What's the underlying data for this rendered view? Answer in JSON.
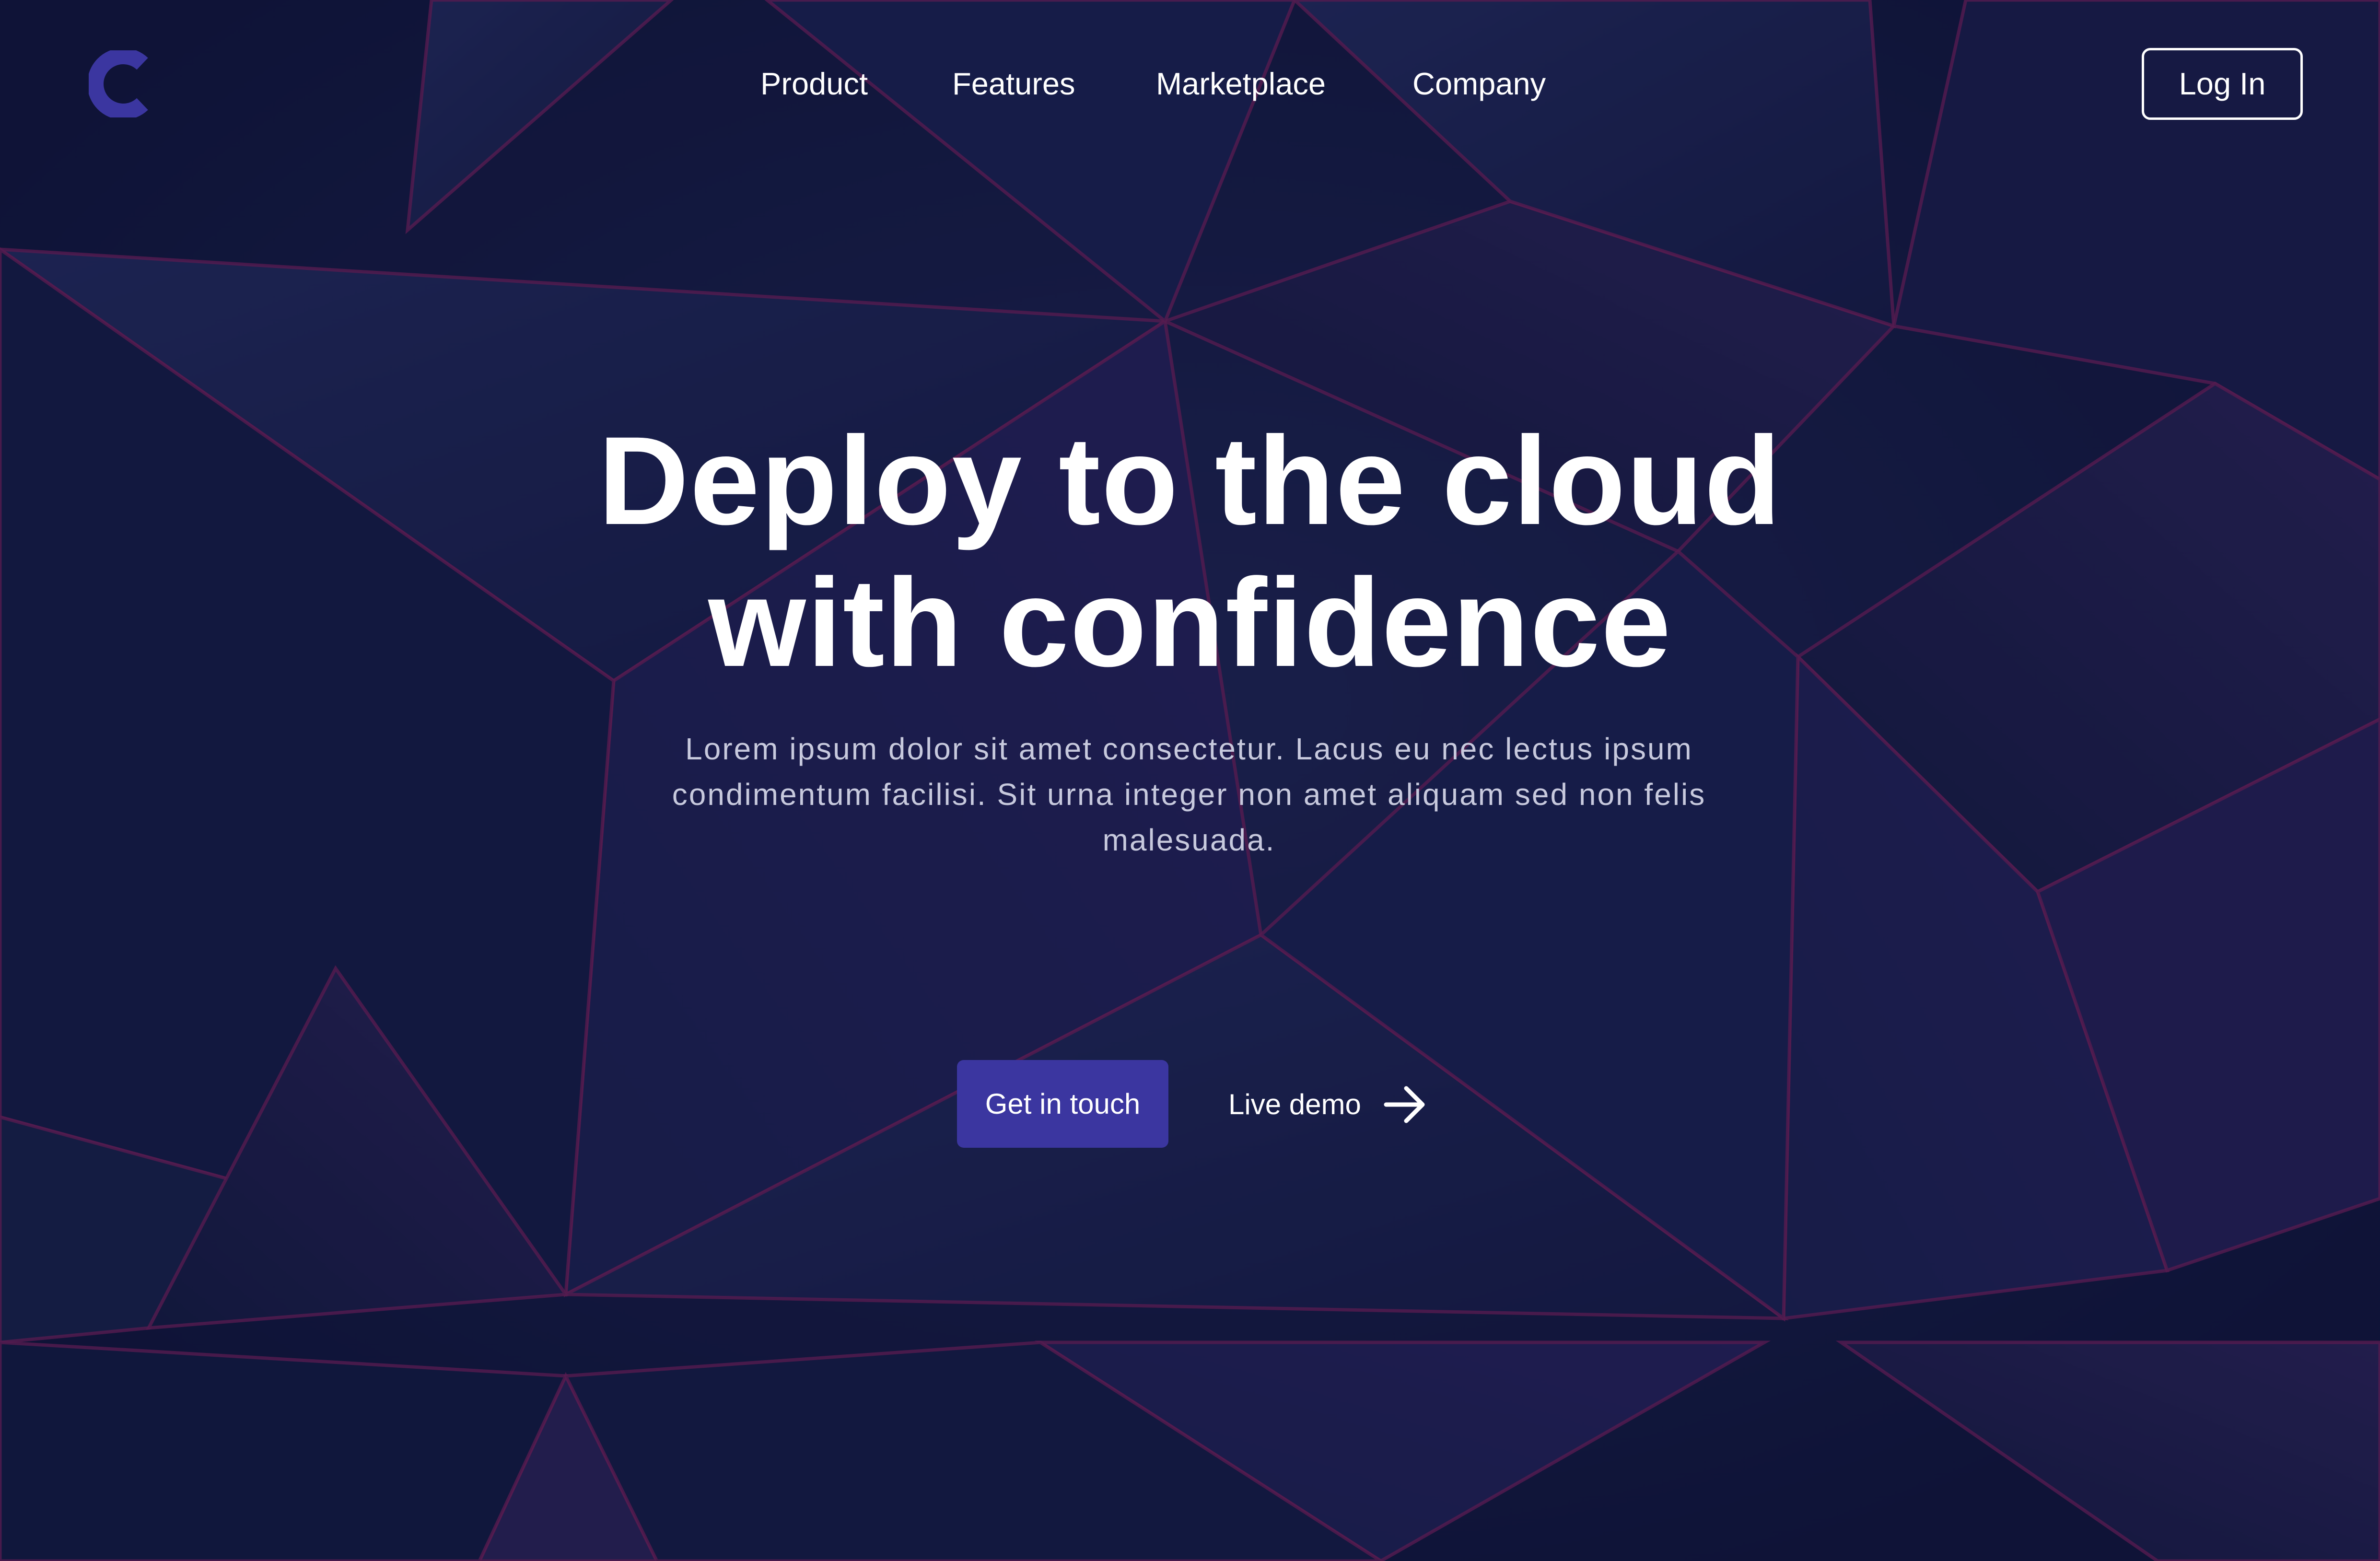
{
  "brand": {
    "logo_icon": "c-logo-icon",
    "accent_color": "#3b36a0"
  },
  "nav": {
    "items": [
      {
        "label": "Product"
      },
      {
        "label": "Features"
      },
      {
        "label": "Marketplace"
      },
      {
        "label": "Company"
      }
    ],
    "login_label": "Log In"
  },
  "hero": {
    "headline_line1": "Deploy to the cloud",
    "headline_line2": "with confidence",
    "subtext_line1": "Lorem ipsum dolor sit amet consectetur. Lacus eu nec lectus ipsum",
    "subtext_line2": "condimentum facilisi. Sit urna integer non amet aliquam sed non felis",
    "subtext_line3": "malesuada.",
    "cta_label": "Get in touch",
    "demo_label": "Live demo",
    "demo_icon": "arrow-right-icon"
  },
  "colors": {
    "background": "#141a3f",
    "facet_edge": "#6e1f5a",
    "subtext": "#c7c9dd"
  }
}
